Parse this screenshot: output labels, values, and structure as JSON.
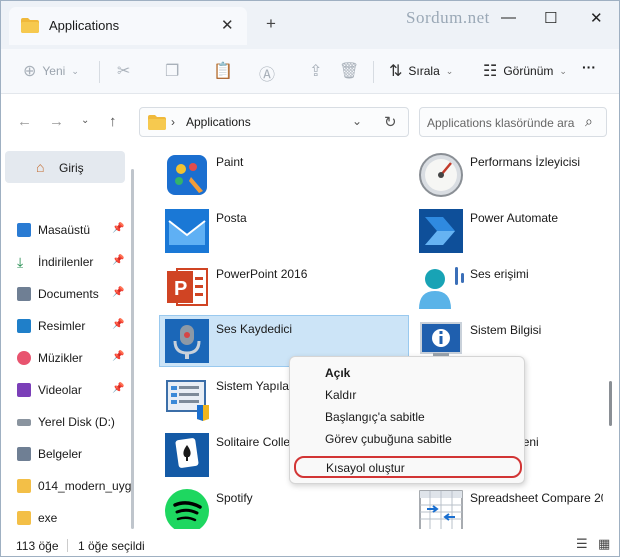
{
  "title_bar": {
    "tab_title": "Applications",
    "tab_close": "✕",
    "new_tab": "+",
    "watermark": "Sordum.net",
    "minimize": "—",
    "maximize": "☐",
    "close": "✕"
  },
  "command_bar": {
    "new_label": "Yeni",
    "sort_label": "Sırala",
    "view_label": "Görünüm",
    "more_label": "···"
  },
  "address_bar": {
    "breadcrumb": "Applications",
    "search_placeholder": "Applications klasöründe ara"
  },
  "sidebar": {
    "home_label": "Giriş",
    "items": [
      {
        "label": "Masaüstü",
        "pinned": true
      },
      {
        "label": "İndirilenler",
        "pinned": true
      },
      {
        "label": "Documents",
        "pinned": true
      },
      {
        "label": "Resimler",
        "pinned": true
      },
      {
        "label": "Müzikler",
        "pinned": true
      },
      {
        "label": "Videolar",
        "pinned": true
      },
      {
        "label": "Yerel Disk (D:)",
        "pinned": false
      },
      {
        "label": "Belgeler",
        "pinned": false
      },
      {
        "label": "014_modern_uyg",
        "pinned": false
      },
      {
        "label": "exe",
        "pinned": false
      }
    ]
  },
  "apps": {
    "left": [
      {
        "name": "Paint",
        "icon": "paint-icon"
      },
      {
        "name": "Posta",
        "icon": "mail-icon"
      },
      {
        "name": "PowerPoint 2016",
        "icon": "powerpoint-icon"
      },
      {
        "name": "Ses Kaydedici",
        "icon": "microphone-icon",
        "selected": true
      },
      {
        "name": "Sistem Yapıları",
        "icon": "system-config-icon"
      },
      {
        "name": "Solitaire Colle",
        "icon": "solitaire-icon"
      },
      {
        "name": "Spotify",
        "icon": "spotify-icon"
      }
    ],
    "right": [
      {
        "name": "Performans İzleyicisi",
        "icon": "gauge-icon"
      },
      {
        "name": "Power Automate",
        "icon": "power-automate-icon"
      },
      {
        "name": "Ses erişimi",
        "icon": "voice-access-icon"
      },
      {
        "name": "Sistem Bilgisi",
        "icon": "system-info-icon"
      },
      {
        "name": "",
        "icon": "blank-icon"
      },
      {
        "name": "de neler yeni",
        "icon": "tips-icon"
      },
      {
        "name": "Spreadsheet Compare 20",
        "icon": "spreadsheet-compare-icon"
      }
    ]
  },
  "context_menu": {
    "items": [
      "Açık",
      "Kaldır",
      "Başlangıç'a sabitle",
      "Görev çubuğuna sabitle",
      "Kısayol oluştur"
    ]
  },
  "status_bar": {
    "count": "113 öğe",
    "selected": "1 öğe seçildi"
  }
}
